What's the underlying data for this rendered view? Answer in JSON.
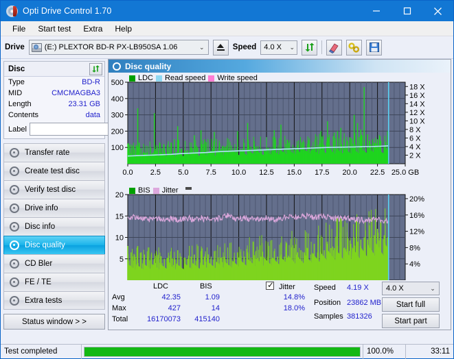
{
  "window": {
    "title": "Opti Drive Control 1.70",
    "icon": "disc-icon",
    "minimize": "–",
    "maximize": "□",
    "close": "✕"
  },
  "menu": [
    "File",
    "Start test",
    "Extra",
    "Help"
  ],
  "toolbar": {
    "drive_label": "Drive",
    "drive_value": "(E:)   PLEXTOR BD-R  PX-LB950SA 1.06",
    "eject_title": "eject-button",
    "speed_label": "Speed",
    "speed_value": "4.0 X",
    "refresh_icon": "refresh-icon",
    "erase_icon": "eraser-icon",
    "tools_icon": "tools-icon",
    "save_icon": "save-icon"
  },
  "disc": {
    "title": "Disc",
    "refresh_icon": "refresh-icon",
    "rows": [
      {
        "key": "Type",
        "value": "BD-R"
      },
      {
        "key": "MID",
        "value": "CMCMAGBA3"
      },
      {
        "key": "Length",
        "value": "23.31 GB"
      },
      {
        "key": "Contents",
        "value": "data"
      }
    ],
    "label_key": "Label",
    "label_value": "",
    "disc_icon": "disc-icon"
  },
  "sidebar": {
    "items": [
      {
        "label": "Transfer rate",
        "active": false
      },
      {
        "label": "Create test disc",
        "active": false
      },
      {
        "label": "Verify test disc",
        "active": false
      },
      {
        "label": "Drive info",
        "active": false
      },
      {
        "label": "Disc info",
        "active": false
      },
      {
        "label": "Disc quality",
        "active": true
      },
      {
        "label": "CD Bler",
        "active": false
      },
      {
        "label": "FE / TE",
        "active": false
      },
      {
        "label": "Extra tests",
        "active": false
      }
    ],
    "status_window": "Status window > >"
  },
  "panel": {
    "title": "Disc quality",
    "icon": "disc-quality-icon"
  },
  "stats": {
    "col_ldc": "LDC",
    "col_bis": "BIS",
    "row_avg": "Avg",
    "row_max": "Max",
    "row_total": "Total",
    "ldc_avg": "42.35",
    "ldc_max": "427",
    "ldc_total": "16170073",
    "bis_avg": "1.09",
    "bis_max": "14",
    "bis_total": "415140",
    "jitter_label": "Jitter",
    "jitter_checked": true,
    "jitter_avg": "14.8%",
    "jitter_max": "18.0%",
    "speed_label": "Speed",
    "speed_value": "4.19 X",
    "position_label": "Position",
    "position_value": "23862 MB",
    "samples_label": "Samples",
    "samples_value": "381326",
    "speed_select": "4.0 X",
    "start_full": "Start full",
    "start_part": "Start part"
  },
  "statusbar": {
    "text": "Test completed",
    "percent": "100.0%",
    "percent_value": 100,
    "time": "33:11"
  },
  "chart_data": [
    {
      "type": "area",
      "name": "ldc-chart",
      "title": "",
      "xlabel": "GB",
      "ylabel": "",
      "xlim": [
        0,
        25
      ],
      "ylim": [
        0,
        500
      ],
      "y2lim": [
        0,
        18
      ],
      "y2label": "X",
      "xticks": [
        "0.0",
        "2.5",
        "5.0",
        "7.5",
        "10.0",
        "12.5",
        "15.0",
        "17.5",
        "20.0",
        "22.5",
        "25.0 GB"
      ],
      "yticks": [
        "100",
        "200",
        "300",
        "400",
        "500"
      ],
      "y2ticks": [
        "2 X",
        "4 X",
        "6 X",
        "8 X",
        "10 X",
        "12 X",
        "14 X",
        "16 X",
        "18 X"
      ],
      "grid": true,
      "legend_position": "top-left",
      "legend": [
        {
          "label": "LDC",
          "color": "#00a000"
        },
        {
          "label": "Read speed",
          "color": "#8fd8f2"
        },
        {
          "label": "Write speed",
          "color": "#ff7ed4"
        }
      ],
      "data_end_gb": 23.5,
      "series": [
        {
          "name": "LDC",
          "color": "#1fd41f",
          "kind": "bars",
          "x": [
            0.0,
            0.3,
            0.6,
            0.9,
            1.2,
            1.5,
            1.8,
            2.1,
            2.4,
            2.7,
            3.0,
            3.3,
            3.6,
            3.9,
            4.2,
            4.5,
            4.8,
            5.1,
            5.4,
            5.7,
            6.0,
            6.3,
            6.6,
            6.9,
            7.2,
            7.5,
            7.8,
            8.1,
            8.4,
            8.7,
            9.0,
            9.3,
            9.6,
            9.9,
            10.2,
            10.5,
            10.8,
            11.1,
            11.4,
            11.7,
            12.0,
            12.3,
            12.6,
            12.9,
            13.2,
            13.5,
            13.8,
            14.1,
            14.4,
            14.7,
            15.0,
            15.3,
            15.6,
            15.9,
            16.2,
            16.5,
            16.8,
            17.1,
            17.4,
            17.7,
            18.0,
            18.3,
            18.6,
            18.9,
            19.2,
            19.5,
            19.8,
            20.1,
            20.4,
            20.7,
            21.0,
            21.3,
            21.6,
            21.9,
            22.2,
            22.5,
            22.8,
            23.1,
            23.4
          ],
          "values": [
            120,
            85,
            70,
            340,
            95,
            70,
            62,
            60,
            310,
            95,
            65,
            90,
            70,
            130,
            150,
            230,
            90,
            80,
            85,
            100,
            175,
            100,
            205,
            120,
            75,
            80,
            195,
            80,
            90,
            105,
            75,
            75,
            75,
            200,
            80,
            90,
            250,
            105,
            115,
            85,
            80,
            85,
            95,
            75,
            205,
            80,
            240,
            90,
            80,
            95,
            85,
            115,
            90,
            100,
            120,
            80,
            95,
            90,
            200,
            115,
            260,
            110,
            190,
            200,
            220,
            120,
            140,
            160,
            300,
            250,
            210,
            470,
            180,
            120,
            130,
            150,
            140,
            110,
            95
          ]
        },
        {
          "name": "Read speed",
          "color": "#aee4f7",
          "kind": "line",
          "x": [
            0.0,
            1.0,
            2.0,
            3.0,
            4.0,
            5.0,
            6.0,
            7.0,
            8.0,
            9.0,
            10.0,
            11.0,
            12.0,
            13.0,
            14.0,
            15.0,
            16.0,
            17.0,
            18.0,
            19.0,
            20.0,
            21.0,
            22.0,
            23.0,
            23.5
          ],
          "values": [
            1.8,
            1.9,
            2.0,
            2.1,
            2.2,
            2.4,
            2.5,
            2.6,
            2.8,
            2.9,
            3.0,
            3.1,
            3.2,
            3.3,
            3.4,
            3.5,
            3.6,
            3.7,
            3.8,
            3.85,
            3.9,
            3.95,
            4.0,
            4.1,
            4.19
          ]
        }
      ]
    },
    {
      "type": "area",
      "name": "bis-jitter-chart",
      "title": "",
      "xlabel": "GB",
      "ylabel": "",
      "xlim": [
        0,
        25
      ],
      "ylim": [
        0,
        20
      ],
      "y2lim": [
        0,
        20
      ],
      "y2label": "%",
      "xticks": [
        "0.0",
        "2.5",
        "5.0",
        "7.5",
        "10.0",
        "12.5",
        "15.0",
        "17.5",
        "20.0",
        "22.5",
        "25.0 GB"
      ],
      "yticks": [
        "5",
        "10",
        "15",
        "20"
      ],
      "y2ticks": [
        "4%",
        "8%",
        "12%",
        "16%",
        "20%"
      ],
      "grid": true,
      "legend_position": "top-left",
      "legend": [
        {
          "label": "BIS",
          "color": "#00a000"
        },
        {
          "label": "Jitter",
          "color": "#dda8dd"
        }
      ],
      "data_end_gb": 23.5,
      "series": [
        {
          "name": "BIS",
          "color": "#7ed41f",
          "kind": "bars",
          "x": [
            0.0,
            0.3,
            0.6,
            0.9,
            1.2,
            1.5,
            1.8,
            2.1,
            2.4,
            2.7,
            3.0,
            3.3,
            3.6,
            3.9,
            4.2,
            4.5,
            4.8,
            5.1,
            5.4,
            5.7,
            6.0,
            6.3,
            6.6,
            6.9,
            7.2,
            7.5,
            7.8,
            8.1,
            8.4,
            8.7,
            9.0,
            9.3,
            9.6,
            9.9,
            10.2,
            10.5,
            10.8,
            11.1,
            11.4,
            11.7,
            12.0,
            12.3,
            12.6,
            12.9,
            13.2,
            13.5,
            13.8,
            14.1,
            14.4,
            14.7,
            15.0,
            15.3,
            15.6,
            15.9,
            16.2,
            16.5,
            16.8,
            17.1,
            17.4,
            17.7,
            18.0,
            18.3,
            18.6,
            18.9,
            19.2,
            19.5,
            19.8,
            20.1,
            20.4,
            20.7,
            21.0,
            21.3,
            21.6,
            21.9,
            22.2,
            22.5,
            22.8,
            23.1,
            23.4
          ],
          "values": [
            8.0,
            6.5,
            6.0,
            8.0,
            6.5,
            6.0,
            5.5,
            5.2,
            5.0,
            5.3,
            5.5,
            5.0,
            5.2,
            5.8,
            5.2,
            7.0,
            5.5,
            5.3,
            5.0,
            5.5,
            6.0,
            5.2,
            6.8,
            5.5,
            5.2,
            5.0,
            6.8,
            5.3,
            5.2,
            5.5,
            5.0,
            5.2,
            5.0,
            6.5,
            5.2,
            5.5,
            6.5,
            5.3,
            5.8,
            5.2,
            5.5,
            5.2,
            5.5,
            5.0,
            6.8,
            5.5,
            6.0,
            5.5,
            5.3,
            6.0,
            7.5,
            6.5,
            7.0,
            6.5,
            7.5,
            6.0,
            8.5,
            6.5,
            8.0,
            7.0,
            8.5,
            7.5,
            7.5,
            8.0,
            9.0,
            7.5,
            8.0,
            8.5,
            10.0,
            9.0,
            9.5,
            10.0,
            9.5,
            10.0,
            10.5,
            12.0,
            14.0,
            10.5,
            10.0
          ]
        },
        {
          "name": "Jitter",
          "color": "#dda8dd",
          "kind": "line",
          "x": [
            0.0,
            0.5,
            1.0,
            1.5,
            2.0,
            2.5,
            3.0,
            3.5,
            4.0,
            4.5,
            5.0,
            5.5,
            6.0,
            6.5,
            7.0,
            7.5,
            8.0,
            8.5,
            9.0,
            9.5,
            10.0,
            10.5,
            11.0,
            11.5,
            12.0,
            12.5,
            13.0,
            13.5,
            14.0,
            14.5,
            15.0,
            15.5,
            16.0,
            16.5,
            17.0,
            17.5,
            18.0,
            18.5,
            19.0,
            19.5,
            20.0,
            20.5,
            21.0,
            21.5,
            22.0,
            22.5,
            23.0,
            23.5
          ],
          "values": [
            15.2,
            15.6,
            15.3,
            15.0,
            14.8,
            15.1,
            15.0,
            14.9,
            15.1,
            14.8,
            15.0,
            15.2,
            14.9,
            15.3,
            15.0,
            14.7,
            15.0,
            15.4,
            16.0,
            15.2,
            15.0,
            15.3,
            15.1,
            14.8,
            15.0,
            15.2,
            15.0,
            14.9,
            15.3,
            15.6,
            15.5,
            15.4,
            15.8,
            15.5,
            15.3,
            16.0,
            15.4,
            15.2,
            15.0,
            15.3,
            15.1,
            14.9,
            14.7,
            14.6,
            14.9,
            15.0,
            14.6,
            14.5
          ]
        }
      ]
    }
  ]
}
